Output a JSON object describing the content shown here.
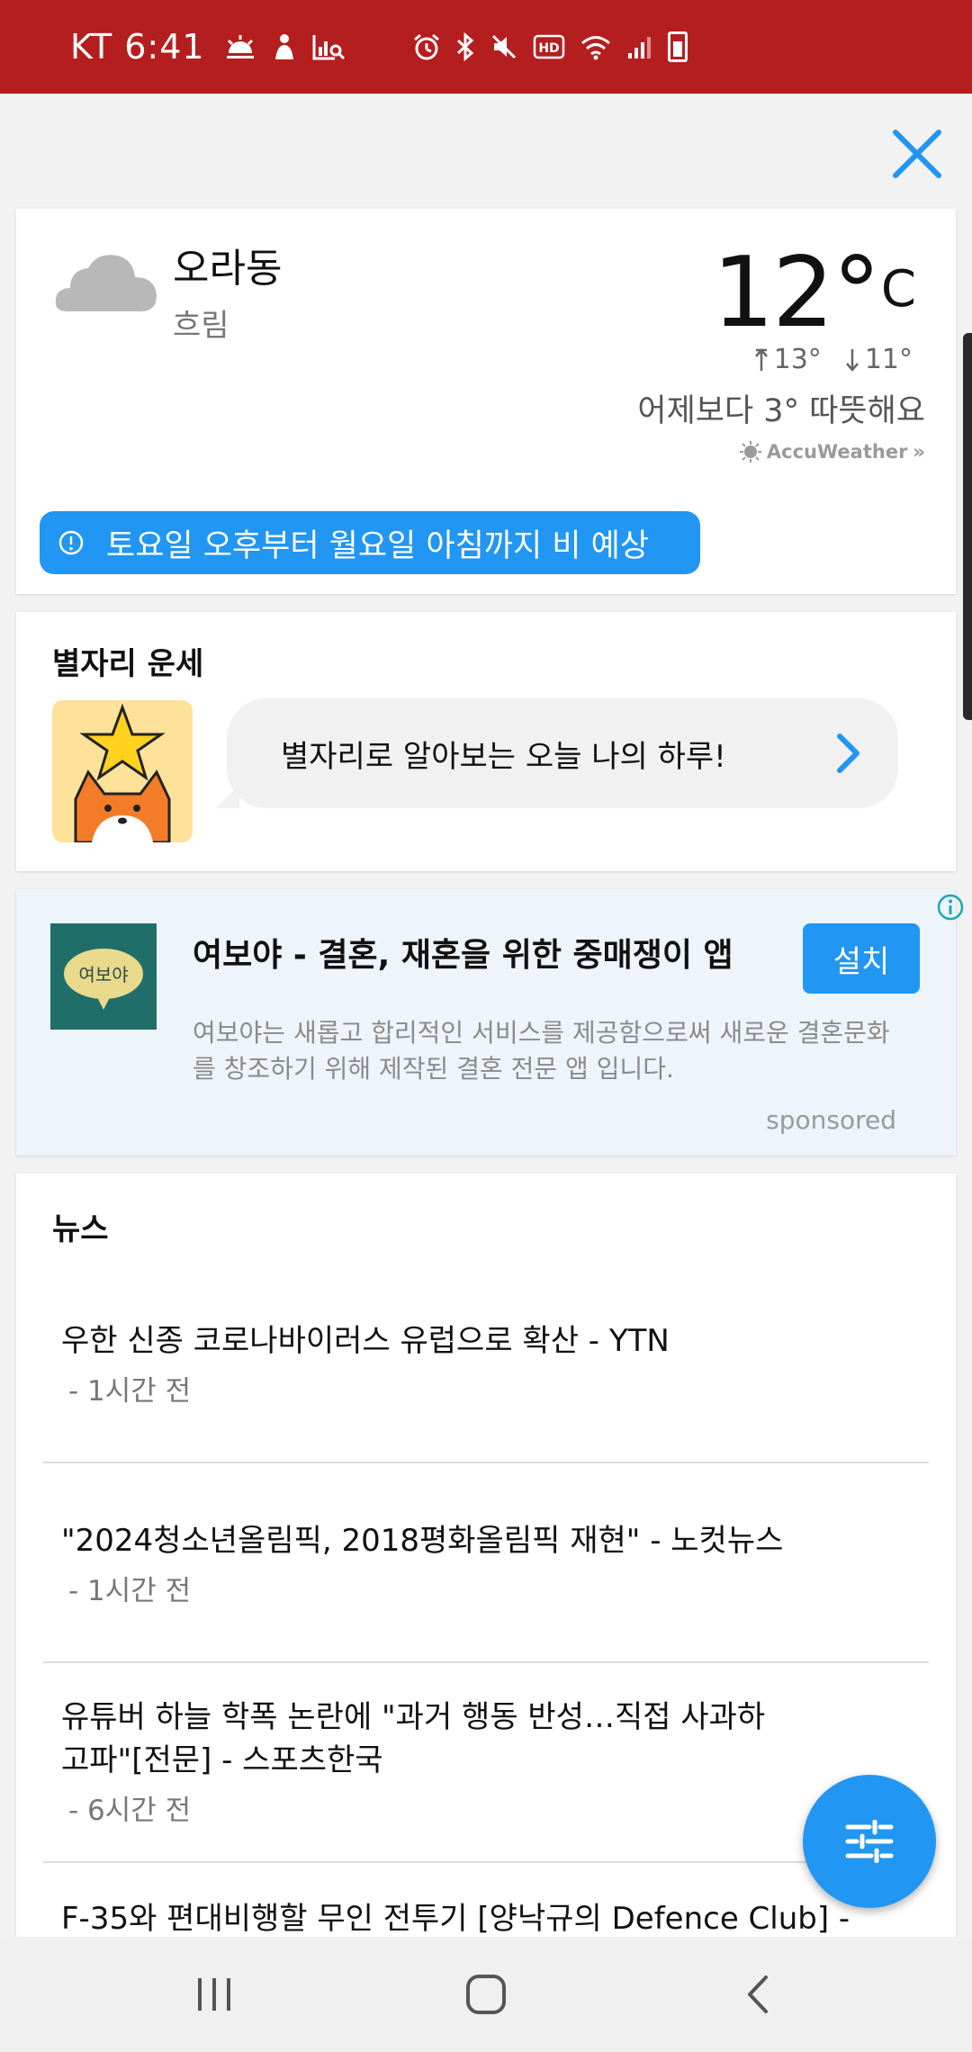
{
  "status_bar": {
    "time": "KT 6:41"
  },
  "weather": {
    "location": "오라동",
    "condition": "흐림",
    "temperature": "12°",
    "unit": "C",
    "high": "13°",
    "low": "11°",
    "comparison": "어제보다 3° 따뜻해요",
    "provider": "AccuWeather",
    "alert": "토요일 오후부터 월요일 아침까지 비 예상"
  },
  "horoscope": {
    "title": "별자리 운세",
    "message": "별자리로 알아보는 오늘 나의 하루!"
  },
  "ad": {
    "title": "여보야 - 결혼, 재혼을 위한 중매쟁이 앱",
    "install_label": "설치",
    "description": "여보야는 새롭고 합리적인 서비스를 제공함으로써 새로운 결혼문화를 창조하기 위해 제작된 결혼 전문 앱 입니다.",
    "sponsored_label": "sponsored",
    "icon_text": "여보야"
  },
  "news": {
    "title": "뉴스",
    "items": [
      {
        "title": "우한 신종 코로나바이러스 유럽으로 확산 - YTN",
        "time": "- 1시간 전"
      },
      {
        "title": "\"2024청소년올림픽, 2018평화올림픽 재현\" - 노컷뉴스",
        "time": "- 1시간 전"
      },
      {
        "title": "유튜버 하늘 학폭 논란에 \"과거 행동 반성…직접 사과하고파\"[전문] - 스포츠한국",
        "time": "- 6시간 전"
      },
      {
        "title": "F-35와 편대비행할 무인 전투기 [양낙규의 Defence Club] -",
        "time": ""
      }
    ]
  },
  "colors": {
    "status_bar": "#b51e1e",
    "accent": "#2196f3",
    "ad_background": "#edf4fa"
  }
}
